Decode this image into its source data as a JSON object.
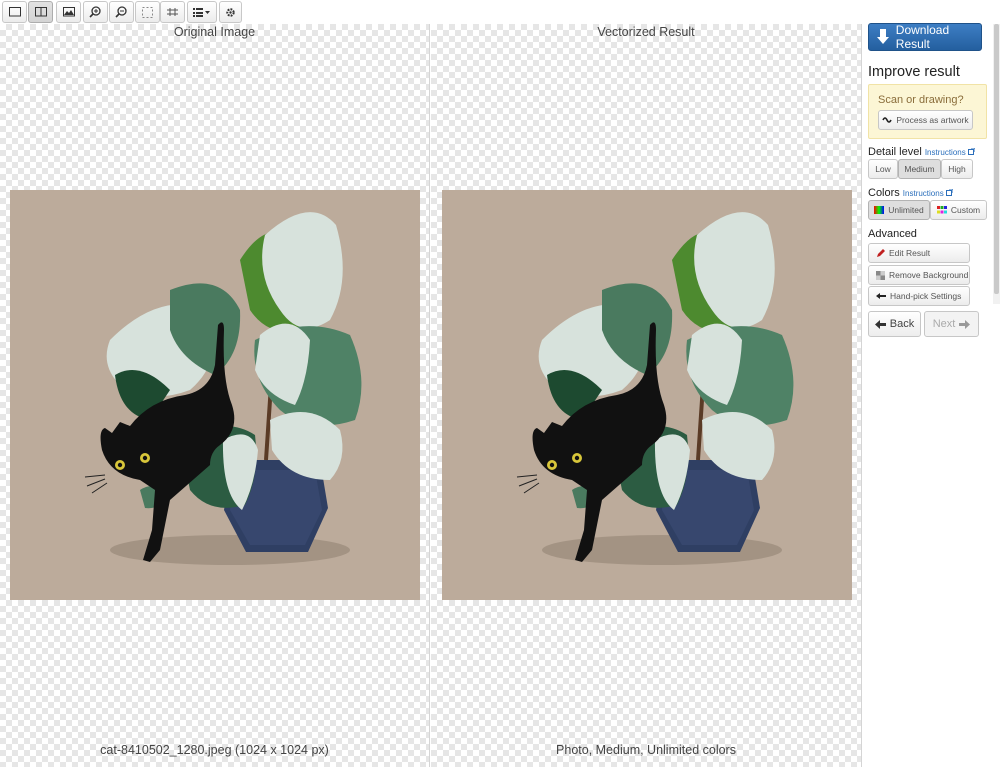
{
  "toolbar": {
    "buttons": [
      {
        "name": "single-view-icon",
        "active": false
      },
      {
        "name": "split-view-icon",
        "active": true
      },
      {
        "name": "image-icon",
        "active": false
      },
      {
        "name": "zoom-in-icon",
        "active": false
      },
      {
        "name": "zoom-out-icon",
        "active": false
      },
      {
        "name": "fit-icon",
        "active": false
      },
      {
        "name": "overlay-icon",
        "active": false
      },
      {
        "name": "list-dropdown-icon",
        "active": false
      },
      {
        "name": "settings-icon",
        "active": false
      }
    ]
  },
  "left_pane": {
    "title": "Original Image",
    "caption": "cat-8410502_1280.jpeg (1024 x 1024 px)"
  },
  "right_pane": {
    "title": "Vectorized Result",
    "caption": "Photo, Medium, Unlimited colors"
  },
  "side": {
    "download_label": "Download Result",
    "improve_heading": "Improve result",
    "scan_label": "Scan or drawing?",
    "process_label": "Process as artwork",
    "detail_label": "Detail level",
    "detail_link": "Instructions",
    "detail_options": [
      "Low",
      "Medium",
      "High"
    ],
    "detail_selected": "Medium",
    "colors_label": "Colors",
    "colors_link": "Instructions",
    "colors_options": [
      "Unlimited",
      "Custom"
    ],
    "colors_selected": "Unlimited",
    "advanced_heading": "Advanced",
    "advanced_buttons": [
      "Edit Result",
      "Remove Background",
      "Hand-pick Settings"
    ],
    "back_label": "Back",
    "next_label": "Next"
  },
  "colors": {
    "accent": "#2e6db0",
    "close": "#d9302a",
    "artwork_bg": "#bcab9b",
    "notice_bg": "#fcf6d5"
  }
}
